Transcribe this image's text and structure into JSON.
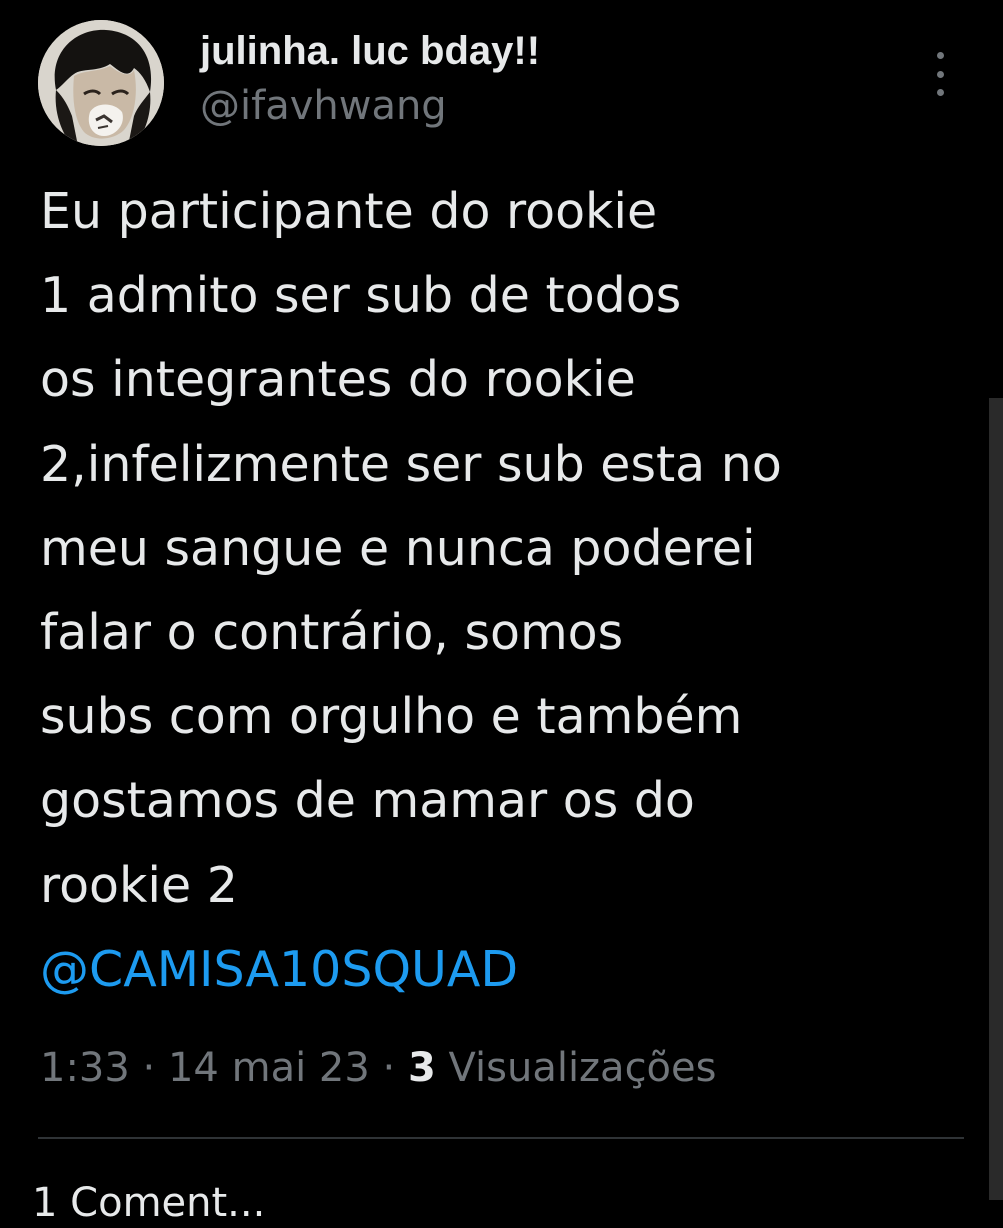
{
  "author": {
    "display_name": "julinha. luc bday!!",
    "handle": "@ifavhwang"
  },
  "tweet": {
    "lines": [
      "Eu participante do rookie",
      "1 admito ser sub de todos",
      "os integrantes do rookie",
      "2,infelizmente ser sub esta no",
      "meu sangue e nunca poderei",
      "falar o contrário, somos",
      "subs com orgulho e também",
      "gostamos de mamar os do",
      "rookie 2"
    ],
    "mention": "@CAMISA10SQUAD"
  },
  "meta": {
    "time": "1:33",
    "separator": " · ",
    "date": "14 mai 23",
    "views_count": "3",
    "views_label": "Visualizações"
  },
  "stats": {
    "partial_label": "1 Coment..."
  },
  "colors": {
    "background": "#000000",
    "text": "#e7e9ea",
    "secondary": "#71767b",
    "link": "#1d9bf0",
    "divider": "#2f3336"
  },
  "icons": {
    "more": "more-vertical-icon",
    "avatar": "profile-avatar-image"
  }
}
